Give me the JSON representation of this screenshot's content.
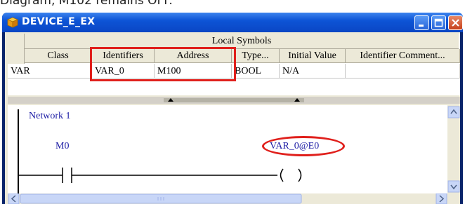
{
  "caption": "Diagram, M102 remains OFF.",
  "window": {
    "title": "DEVICE_E_EX",
    "buttons": {
      "minimize": "minimize",
      "maximize": "maximize",
      "close": "close"
    }
  },
  "symbols": {
    "header": "Local Symbols",
    "columns": [
      "Class",
      "Identifiers",
      "Address",
      "Type...",
      "Initial Value",
      "Identifier Comment..."
    ],
    "rows": [
      {
        "class": "VAR",
        "identifier": "VAR_0",
        "address": "M100",
        "type": "BOOL",
        "initial_value": "N/A",
        "comment": ""
      }
    ]
  },
  "ladder": {
    "network_label": "Network 1",
    "contact_label": "M0",
    "coil_label": "VAR_0@E0",
    "coil_symbol": "( )"
  },
  "colors": {
    "title_bar": "#0d54d6",
    "highlight": "#e0201c",
    "ladder_text": "#1d1da5"
  }
}
